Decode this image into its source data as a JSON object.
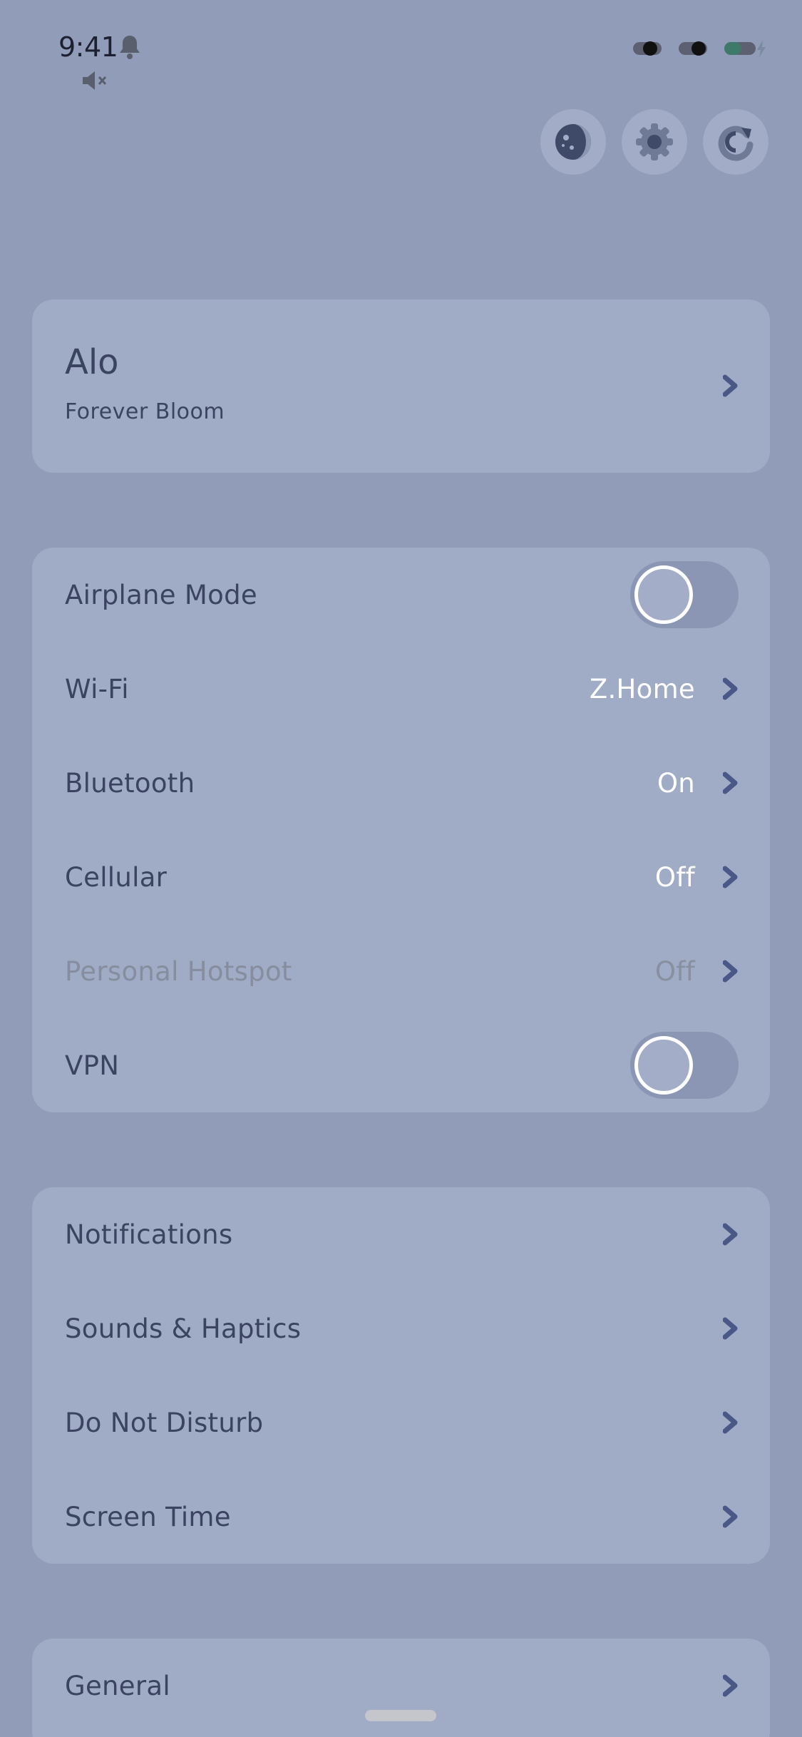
{
  "status_bar": {
    "time": "9:41"
  },
  "profile": {
    "name": "Alo",
    "subtitle": "Forever Bloom"
  },
  "connectivity": {
    "airplane_mode": {
      "label": "Airplane Mode",
      "on": false
    },
    "wifi": {
      "label": "Wi-Fi",
      "value": "Z.Home"
    },
    "bluetooth": {
      "label": "Bluetooth",
      "value": "On"
    },
    "cellular": {
      "label": "Cellular",
      "value": "Off"
    },
    "hotspot": {
      "label": "Personal Hotspot",
      "value": "Off",
      "disabled": true
    },
    "vpn": {
      "label": "VPN",
      "on": false
    }
  },
  "alerts": {
    "notifications": {
      "label": "Notifications"
    },
    "sounds": {
      "label": "Sounds & Haptics"
    },
    "dnd": {
      "label": "Do Not Disturb"
    },
    "screen_time": {
      "label": "Screen Time"
    }
  },
  "general": {
    "general": {
      "label": "General"
    }
  },
  "icons": {
    "top_buttons": [
      "moon-icon",
      "gear-icon",
      "refresh-icon"
    ],
    "chevron": "chevron-right-icon"
  },
  "colors": {
    "background": "#909cb8",
    "card": "#a0abc5",
    "text": "#3a4360",
    "chevron": "#4a5888",
    "value": "#ffffff"
  }
}
